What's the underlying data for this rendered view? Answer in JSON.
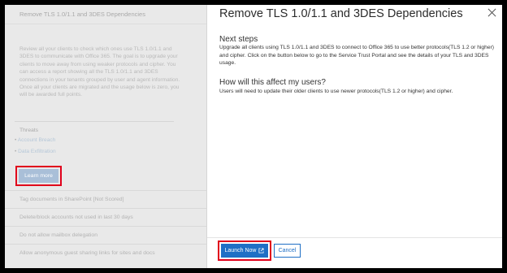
{
  "background_page": {
    "header_title": "Remove TLS 1.0/1.1 and 3DES Dependencies",
    "description": "Review all your clients to check which ones use TLS 1.0/1.1 and 3DES to communicate with Office 365. The goal is to upgrade your clients to move away from using weaker protocols and cipher. You can access a report showing all the TLS 1.0/1.1 and 3DES connections in your tenants grouped by user and agent information. Once all your clients are migrated and the usage below is zero, you will be awarded full points.",
    "threats_heading": "Threats",
    "threats": [
      "Account Breach",
      "Data Exfiltration"
    ],
    "learn_more_label": "Learn more",
    "other_actions": [
      "Tag documents in SharePoint [Not Scored]",
      "Delete/block accounts not used in last 30 days",
      "Do not allow mailbox delegation",
      "Allow anonymous guest sharing links for sites and docs"
    ]
  },
  "panel": {
    "title": "Remove TLS 1.0/1.1 and 3DES Dependencies",
    "next_steps_heading": "Next steps",
    "next_steps_body": "Upgrade all clients using TLS 1.0/1.1 and 3DES to connect to Office 365 to use better protocols(TLS 1.2 or higher) and cipher. Click on the button below to go to the Service Trust Portal and see the details of your TLS and 3DES usage.",
    "impact_heading": "How will this affect my users?",
    "impact_body": "Users will need to update their older clients to use newer protocols(TLS 1.2 or higher) and cipher.",
    "launch_label": "Launch Now",
    "cancel_label": "Cancel"
  },
  "colors": {
    "primary": "#1f6fc5",
    "highlight": "#e0001b"
  }
}
